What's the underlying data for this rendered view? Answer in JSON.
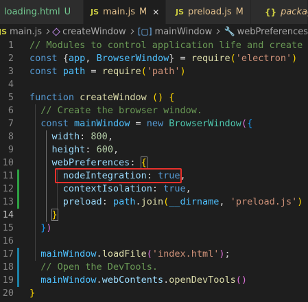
{
  "tabs": [
    {
      "label": "loading.html",
      "status": "U",
      "status_color": "#73c991",
      "label_color": "#73c991",
      "icon": "html-icon",
      "active": false
    },
    {
      "label": "main.js",
      "status": "M",
      "status_color": "#e2c08d",
      "label_color": "#e2c08d",
      "icon": "js-icon",
      "icon_text": "JS",
      "active": true,
      "close": "✕"
    },
    {
      "label": "preload.js",
      "status": "M",
      "status_color": "#e2c08d",
      "label_color": "#e2c08d",
      "icon": "js-icon",
      "icon_text": "JS",
      "active": false
    },
    {
      "label": "package",
      "icon": "json-icon",
      "icon_text": "{}",
      "active": false
    }
  ],
  "breadcrumb": {
    "file": "main.js",
    "items": [
      "createWindow",
      "mainWindow",
      "webPreferences"
    ]
  },
  "lines": [
    {
      "n": "1",
      "tokens": [
        [
          "c",
          "// Modules to control application life and create nat"
        ]
      ]
    },
    {
      "n": "2",
      "tokens": [
        [
          "k",
          "const"
        ],
        [
          "d",
          " {"
        ],
        [
          "v",
          "app"
        ],
        [
          "d",
          ", "
        ],
        [
          "v",
          "BrowserWindow"
        ],
        [
          "d",
          "} = "
        ],
        [
          "f",
          "require"
        ],
        [
          "b1",
          "("
        ],
        [
          "s",
          "'electron'"
        ],
        [
          "b1",
          ")"
        ]
      ]
    },
    {
      "n": "3",
      "tokens": [
        [
          "k",
          "const"
        ],
        [
          "d",
          " "
        ],
        [
          "v",
          "path"
        ],
        [
          "d",
          " = "
        ],
        [
          "f",
          "require"
        ],
        [
          "b1",
          "("
        ],
        [
          "s",
          "'path'"
        ],
        [
          "b1",
          ")"
        ]
      ]
    },
    {
      "n": "4",
      "tokens": []
    },
    {
      "n": "5",
      "tokens": [
        [
          "k",
          "function"
        ],
        [
          "d",
          " "
        ],
        [
          "f",
          "createWindow"
        ],
        [
          "d",
          " "
        ],
        [
          "b1",
          "()"
        ],
        [
          "d",
          " "
        ],
        [
          "b1",
          "{"
        ]
      ]
    },
    {
      "n": "6",
      "tokens": [
        [
          "d",
          "  "
        ],
        [
          "c",
          "// Create the browser window."
        ]
      ]
    },
    {
      "n": "7",
      "tokens": [
        [
          "d",
          "  "
        ],
        [
          "k",
          "const"
        ],
        [
          "d",
          " "
        ],
        [
          "v",
          "mainWindow"
        ],
        [
          "d",
          " = "
        ],
        [
          "k",
          "new"
        ],
        [
          "d",
          " "
        ],
        [
          "cl",
          "BrowserWindow"
        ],
        [
          "b2",
          "("
        ],
        [
          "b3",
          "{"
        ]
      ]
    },
    {
      "n": "8",
      "tokens": [
        [
          "d",
          "    "
        ],
        [
          "p",
          "width"
        ],
        [
          "d",
          ": "
        ],
        [
          "nu",
          "800"
        ],
        [
          "d",
          ","
        ]
      ]
    },
    {
      "n": "9",
      "tokens": [
        [
          "d",
          "    "
        ],
        [
          "p",
          "height"
        ],
        [
          "d",
          ": "
        ],
        [
          "nu",
          "600"
        ],
        [
          "d",
          ","
        ]
      ]
    },
    {
      "n": "10",
      "tokens": [
        [
          "d",
          "    "
        ],
        [
          "p",
          "webPreferences"
        ],
        [
          "d",
          ": "
        ],
        [
          "b1m",
          "{"
        ]
      ]
    },
    {
      "n": "11",
      "tokens": [
        [
          "d",
          "      "
        ],
        [
          "p",
          "nodeIntegration"
        ],
        [
          "d",
          ": "
        ],
        [
          "k",
          "true"
        ],
        [
          "d",
          ","
        ]
      ]
    },
    {
      "n": "12",
      "tokens": [
        [
          "d",
          "      "
        ],
        [
          "p",
          "contextIsolation"
        ],
        [
          "d",
          ": "
        ],
        [
          "k",
          "true"
        ],
        [
          "d",
          ","
        ]
      ]
    },
    {
      "n": "13",
      "tokens": [
        [
          "d",
          "      "
        ],
        [
          "p",
          "preload"
        ],
        [
          "d",
          ": "
        ],
        [
          "v",
          "path"
        ],
        [
          "d",
          "."
        ],
        [
          "f",
          "join"
        ],
        [
          "b1",
          "("
        ],
        [
          "v",
          "__dirname"
        ],
        [
          "d",
          ", "
        ],
        [
          "s",
          "'preload.js'"
        ],
        [
          "b1",
          ")"
        ]
      ]
    },
    {
      "n": "14",
      "tokens": [
        [
          "d",
          "    "
        ],
        [
          "b1m",
          "}"
        ]
      ],
      "current": true
    },
    {
      "n": "15",
      "tokens": [
        [
          "d",
          "  "
        ],
        [
          "b3",
          "}"
        ],
        [
          "b2",
          ")"
        ]
      ]
    },
    {
      "n": "16",
      "tokens": []
    },
    {
      "n": "17",
      "tokens": [
        [
          "d",
          "  "
        ],
        [
          "v",
          "mainWindow"
        ],
        [
          "d",
          "."
        ],
        [
          "f",
          "loadFile"
        ],
        [
          "b2",
          "("
        ],
        [
          "s",
          "'index.html'"
        ],
        [
          "b2",
          ")"
        ],
        [
          "d",
          ";"
        ]
      ]
    },
    {
      "n": "18",
      "tokens": [
        [
          "d",
          "  "
        ],
        [
          "c",
          "// Open the DevTools."
        ]
      ]
    },
    {
      "n": "19",
      "tokens": [
        [
          "d",
          "  "
        ],
        [
          "v",
          "mainWindow"
        ],
        [
          "d",
          "."
        ],
        [
          "p",
          "webContents"
        ],
        [
          "d",
          "."
        ],
        [
          "f",
          "openDevTools"
        ],
        [
          "b2",
          "()"
        ]
      ]
    },
    {
      "n": "20",
      "tokens": [
        [
          "b1",
          "}"
        ]
      ]
    }
  ],
  "gutter_marks": [
    {
      "line": 11,
      "color": "#2ea043"
    },
    {
      "line": 12,
      "color": "#2ea043"
    },
    {
      "line": 13,
      "color": "#2ea043"
    },
    {
      "line": 17,
      "color": "#1b81a8"
    },
    {
      "line": 18,
      "color": "#1b81a8"
    },
    {
      "line": 19,
      "color": "#1b81a8"
    }
  ],
  "highlight": {
    "color": "#e8312c",
    "line": 11
  }
}
